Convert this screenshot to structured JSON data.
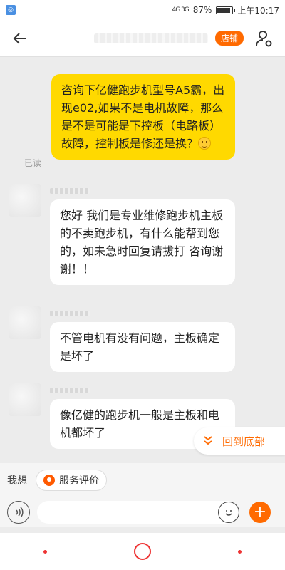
{
  "status": {
    "signal_text": "4G 3G",
    "battery": "87%",
    "time": "上午10:17",
    "battery_level": 0.87
  },
  "header": {
    "shop_badge": "店铺"
  },
  "messages": {
    "me": {
      "text": "咨询下亿健跑步机型号A5霸，出现e02,如果不是电机故障，那么是不是可能是下控板（电路板）故障，控制板是修还是换？",
      "emoji": "smile",
      "read_label": "已读"
    },
    "reply1": "您好 我们是专业维修跑步机主板的不卖跑步机，有什么能帮到您的，如未急时回复请拔打            咨询谢谢！！",
    "reply2": "不管电机有没有问题，主板确定是坏了",
    "reply3": "像亿健的跑步机一般是主板和电机都坏了"
  },
  "jump_bottom": {
    "label": "回到底部",
    "icon": "double-chevron-down-icon"
  },
  "quickbar": {
    "label": "我想",
    "chip": "服务评价"
  },
  "input": {
    "placeholder": ""
  },
  "colors": {
    "accent": "#ff6a00",
    "my_bubble": "#ffd900"
  }
}
